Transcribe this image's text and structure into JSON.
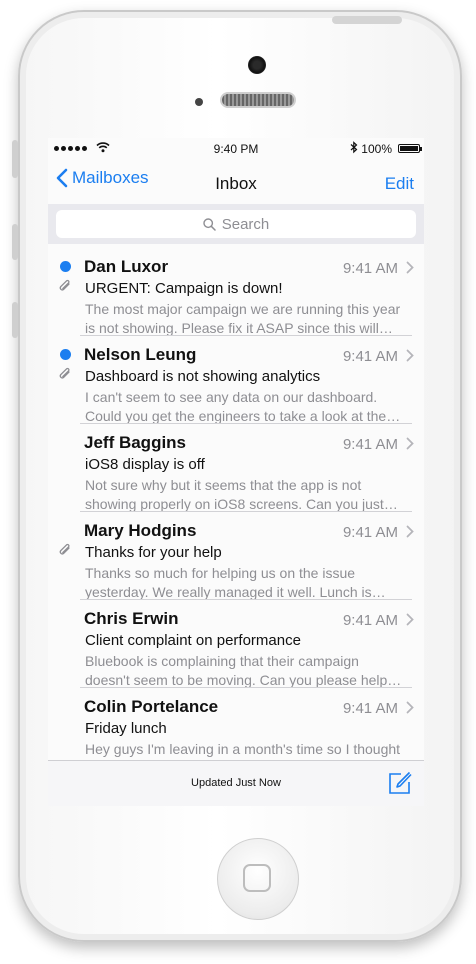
{
  "status_bar": {
    "time": "9:40 PM",
    "battery": "100%"
  },
  "nav": {
    "back_label": "Mailboxes",
    "title": "Inbox",
    "edit_label": "Edit"
  },
  "search": {
    "placeholder": "Search"
  },
  "messages": [
    {
      "sender": "Dan Luxor",
      "time": "9:41 AM",
      "subject": "URGENT: Campaign is down!",
      "preview_line1": "The most major campaign we are running this year",
      "preview_line2": "is not showing. Please fix it ASAP since this will…",
      "unread": true,
      "attachment": true
    },
    {
      "sender": "Nelson Leung",
      "time": "9:41 AM",
      "subject": "Dashboard is not showing analytics",
      "preview_line1": "I can't seem to see any data on our dashboard.",
      "preview_line2": "Could you get the engineers to take a look at the…",
      "unread": true,
      "attachment": true
    },
    {
      "sender": "Jeff Baggins",
      "time": "9:41 AM",
      "subject": "iOS8 display is off",
      "preview_line1": "Not sure why but it seems that the app is not",
      "preview_line2": "showing properly on iOS8 screens. Can you just…",
      "unread": false,
      "attachment": false
    },
    {
      "sender": "Mary Hodgins",
      "time": "9:41 AM",
      "subject": "Thanks for your help",
      "preview_line1": "Thanks so much for helping us on the issue",
      "preview_line2": "yesterday. We really managed it well. Lunch is…",
      "unread": false,
      "attachment": true
    },
    {
      "sender": "Chris Erwin",
      "time": "9:41 AM",
      "subject": "Client complaint on performance",
      "preview_line1": "Bluebook is complaining that their campaign",
      "preview_line2": "doesn't seem to be moving. Can you please help…",
      "unread": false,
      "attachment": false
    },
    {
      "sender": "Colin Portelance",
      "time": "9:41 AM",
      "subject": "Friday lunch",
      "preview_line1": "Hey guys I'm leaving in a month's time so I thought",
      "preview_line2": "",
      "unread": false,
      "attachment": false
    }
  ],
  "toolbar": {
    "status": "Updated Just Now"
  },
  "colors": {
    "accent": "#1b7ef0",
    "secondary_text": "#8e8e93"
  }
}
